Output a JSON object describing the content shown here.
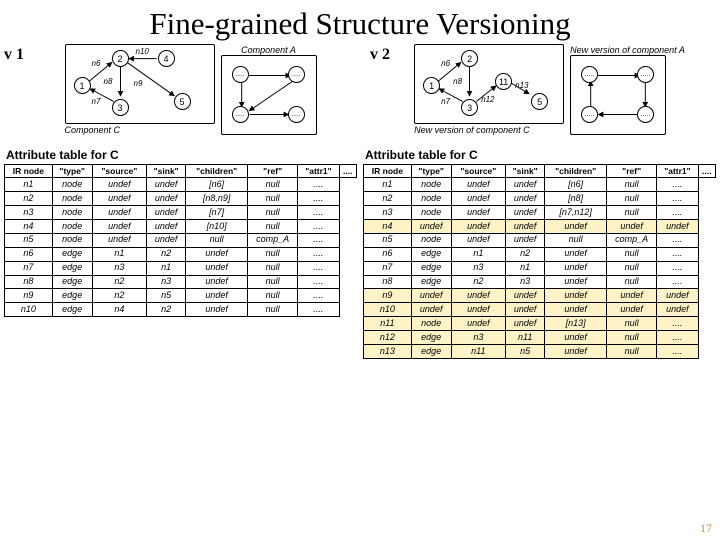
{
  "title": "Fine-grained Structure Versioning",
  "page_number": "17",
  "v1": {
    "label": "v 1",
    "graph_caption": "Component C",
    "comp_caption": "Component A",
    "nodes_main": [
      "1",
      "2",
      "3",
      "4",
      "5"
    ],
    "edge_labels": [
      "n6",
      "n7",
      "n8",
      "n9",
      "n10"
    ],
    "nodes_comp": [
      ".....",
      ".....",
      ".....",
      "....."
    ],
    "table_caption": "Attribute table for C",
    "headers": [
      "IR node",
      "\"type\"",
      "\"source\"",
      "\"sink\"",
      "\"children\"",
      "\"ref\"",
      "\"attr1\"",
      "...."
    ],
    "rows": [
      {
        "c": [
          "n1",
          "node",
          "undef",
          "undef",
          "[n6]",
          "null",
          "...."
        ],
        "hl": false
      },
      {
        "c": [
          "n2",
          "node",
          "undef",
          "undef",
          "[n8,n9]",
          "null",
          "...."
        ],
        "hl": false
      },
      {
        "c": [
          "n3",
          "node",
          "undef",
          "undef",
          "[n7]",
          "null",
          "...."
        ],
        "hl": false
      },
      {
        "c": [
          "n4",
          "node",
          "undef",
          "undef",
          "[n10]",
          "null",
          "...."
        ],
        "hl": false
      },
      {
        "c": [
          "n5",
          "node",
          "undef",
          "undef",
          "null",
          "comp_A",
          "...."
        ],
        "hl": false
      },
      {
        "c": [
          "n6",
          "edge",
          "n1",
          "n2",
          "undef",
          "null",
          "...."
        ],
        "hl": false
      },
      {
        "c": [
          "n7",
          "edge",
          "n3",
          "n1",
          "undef",
          "null",
          "...."
        ],
        "hl": false
      },
      {
        "c": [
          "n8",
          "edge",
          "n2",
          "n3",
          "undef",
          "null",
          "...."
        ],
        "hl": false
      },
      {
        "c": [
          "n9",
          "edge",
          "n2",
          "n5",
          "undef",
          "null",
          "...."
        ],
        "hl": false
      },
      {
        "c": [
          "n10",
          "edge",
          "n4",
          "n2",
          "undef",
          "null",
          "...."
        ],
        "hl": false
      }
    ]
  },
  "v2": {
    "label": "v 2",
    "graph_caption": "New version of component C",
    "comp_caption": "New version of component A",
    "nodes_main": [
      "1",
      "2",
      "3",
      "11",
      "5"
    ],
    "edge_labels": [
      "n6",
      "n7",
      "n8",
      "n12",
      "n13"
    ],
    "nodes_comp": [
      ".....",
      ".....",
      ".....",
      "....."
    ],
    "table_caption": "Attribute table for C",
    "headers": [
      "IR node",
      "\"type\"",
      "\"source\"",
      "\"sink\"",
      "\"children\"",
      "\"ref\"",
      "\"attr1\"",
      "...."
    ],
    "rows": [
      {
        "c": [
          "n1",
          "node",
          "undef",
          "undef",
          "[n6]",
          "null",
          "...."
        ],
        "hl": false
      },
      {
        "c": [
          "n2",
          "node",
          "undef",
          "undef",
          "[n8]",
          "null",
          "...."
        ],
        "hl": false
      },
      {
        "c": [
          "n3",
          "node",
          "undef",
          "undef",
          "[n7,n12]",
          "null",
          "...."
        ],
        "hl": false
      },
      {
        "c": [
          "n4",
          "undef",
          "undef",
          "undef",
          "undef",
          "undef",
          "undef"
        ],
        "hl": true
      },
      {
        "c": [
          "n5",
          "node",
          "undef",
          "undef",
          "null",
          "comp_A",
          "...."
        ],
        "hl": false
      },
      {
        "c": [
          "n6",
          "edge",
          "n1",
          "n2",
          "undef",
          "null",
          "...."
        ],
        "hl": false
      },
      {
        "c": [
          "n7",
          "edge",
          "n3",
          "n1",
          "undef",
          "null",
          "...."
        ],
        "hl": false
      },
      {
        "c": [
          "n8",
          "edge",
          "n2",
          "n3",
          "undef",
          "null",
          "...."
        ],
        "hl": false
      },
      {
        "c": [
          "n9",
          "undef",
          "undef",
          "undef",
          "undef",
          "undef",
          "undef"
        ],
        "hl": true
      },
      {
        "c": [
          "n10",
          "undef",
          "undef",
          "undef",
          "undef",
          "undef",
          "undef"
        ],
        "hl": true
      },
      {
        "c": [
          "n11",
          "node",
          "undef",
          "undef",
          "[n13]",
          "null",
          "...."
        ],
        "hl": true
      },
      {
        "c": [
          "n12",
          "edge",
          "n3",
          "n11",
          "undef",
          "null",
          "...."
        ],
        "hl": true
      },
      {
        "c": [
          "n13",
          "edge",
          "n11",
          "n5",
          "undef",
          "null",
          "...."
        ],
        "hl": true
      }
    ]
  }
}
